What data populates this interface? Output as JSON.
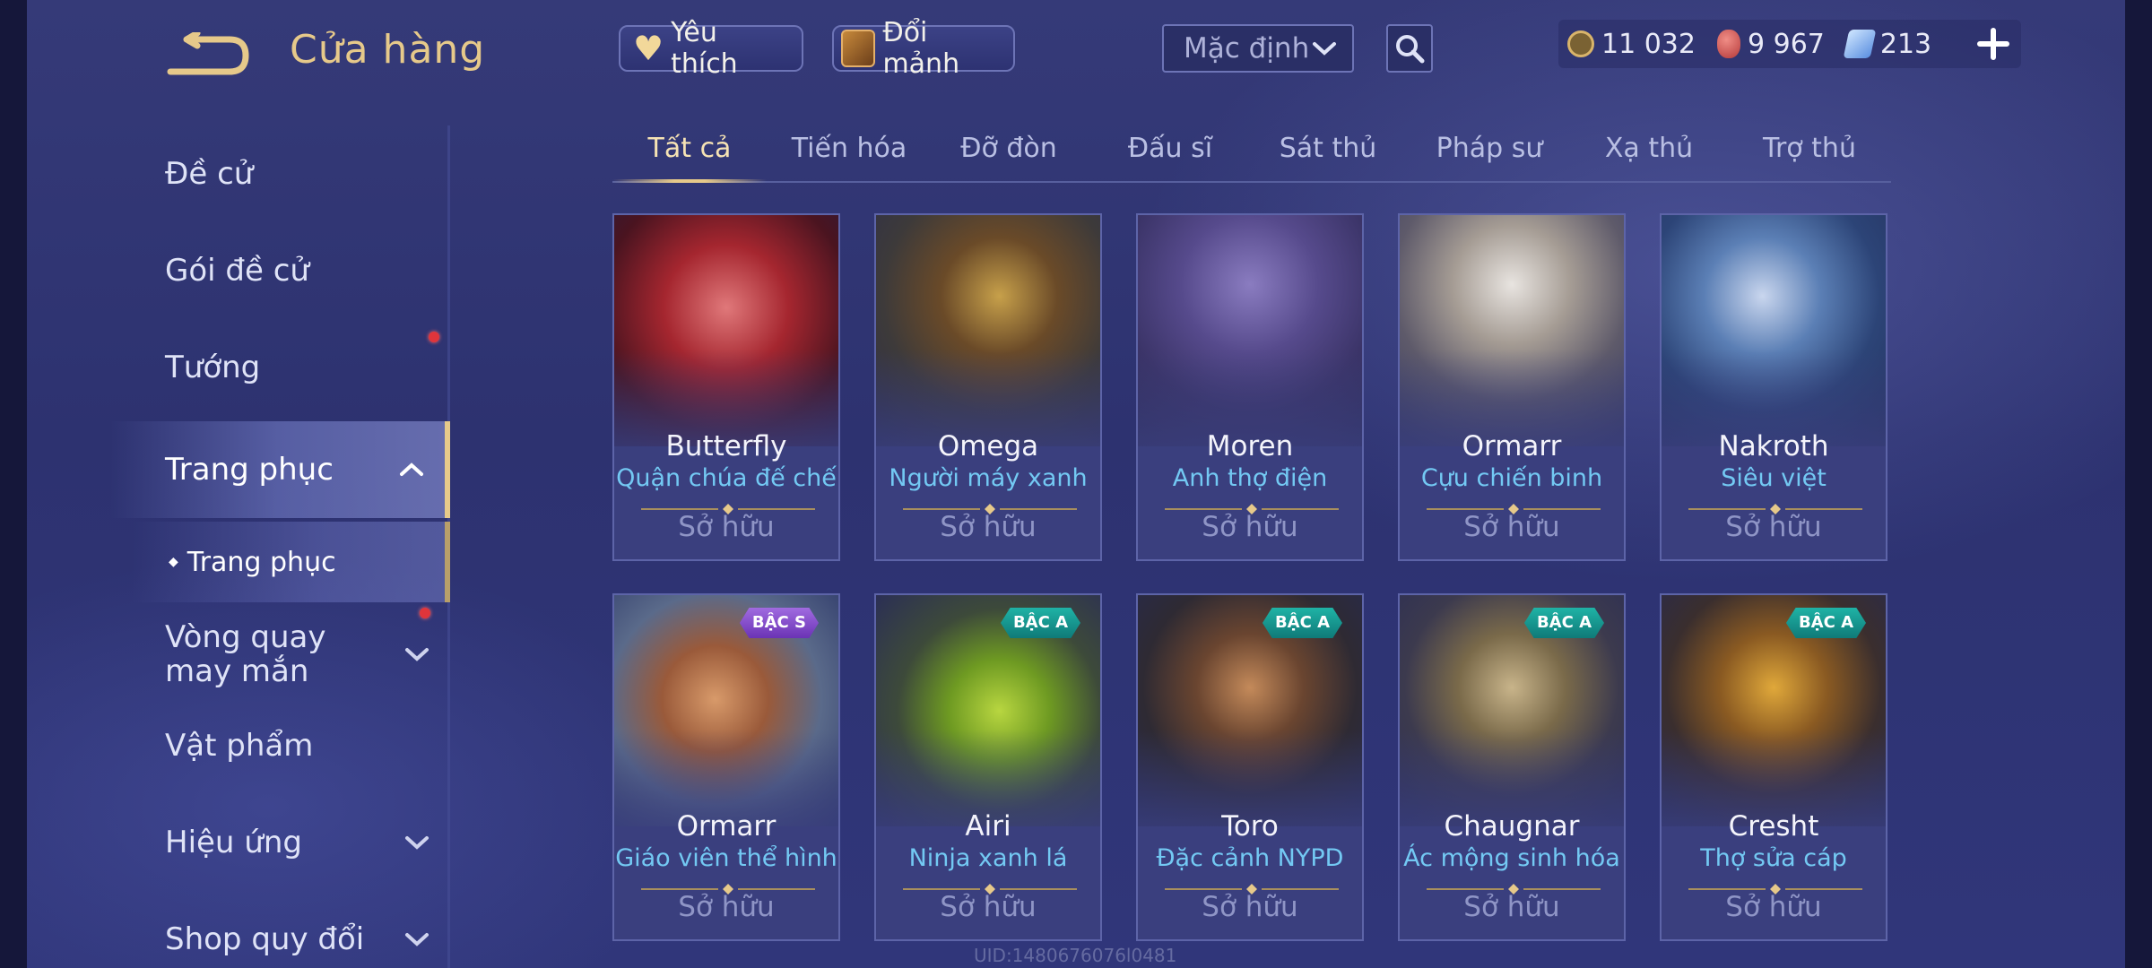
{
  "header": {
    "title": "Cửa hàng",
    "favorites_label": "Yêu thích",
    "shards_label": "Đổi mảnh",
    "sort_value": "Mặc định",
    "currencies": {
      "gold": "11 032",
      "rubies": "9 967",
      "vouchers": "213"
    }
  },
  "sidebar": {
    "items": [
      {
        "label": "Đề cử"
      },
      {
        "label": "Gói đề cử"
      },
      {
        "label": "Tướng"
      },
      {
        "label": "Trang phục"
      },
      {
        "label": "Vòng quay may mắn"
      },
      {
        "label": "Vật phẩm"
      },
      {
        "label": "Hiệu ứng"
      },
      {
        "label": "Shop quy đổi"
      }
    ],
    "subitem": "Trang phục"
  },
  "tabs": [
    "Tất cả",
    "Tiến hóa",
    "Đỡ đòn",
    "Đấu sĩ",
    "Sát thủ",
    "Pháp sư",
    "Xạ thủ",
    "Trợ thủ"
  ],
  "cards": [
    {
      "hero": "Butterfly",
      "skin": "Quận chúa đế chế",
      "status": "Sở hữu",
      "tier": ""
    },
    {
      "hero": "Omega",
      "skin": "Người máy xanh",
      "status": "Sở hữu",
      "tier": ""
    },
    {
      "hero": "Moren",
      "skin": "Anh thợ điện",
      "status": "Sở hữu",
      "tier": ""
    },
    {
      "hero": "Ormarr",
      "skin": "Cựu chiến binh",
      "status": "Sở hữu",
      "tier": ""
    },
    {
      "hero": "Nakroth",
      "skin": "Siêu việt",
      "status": "Sở hữu",
      "tier": ""
    },
    {
      "hero": "Ormarr",
      "skin": "Giáo viên thể hình",
      "status": "Sở hữu",
      "tier": "BẬC S"
    },
    {
      "hero": "Airi",
      "skin": "Ninja xanh lá",
      "status": "Sở hữu",
      "tier": "BẬC A"
    },
    {
      "hero": "Toro",
      "skin": "Đặc cảnh NYPD",
      "status": "Sở hữu",
      "tier": "BẬC A"
    },
    {
      "hero": "Chaugnar",
      "skin": "Ác mộng sinh hóa",
      "status": "Sở hữu",
      "tier": "BẬC A"
    },
    {
      "hero": "Cresht",
      "skin": "Thợ sửa cáp",
      "status": "Sở hữu",
      "tier": "BẬC A"
    }
  ],
  "watermark": "UID:1480676076l0481",
  "colors": {
    "accent_gold": "#e6c98a",
    "skin_name": "#73c9f3",
    "tier_a": "#1fb3a6",
    "tier_s": "#a06be0",
    "notify_dot": "#e0353b"
  }
}
